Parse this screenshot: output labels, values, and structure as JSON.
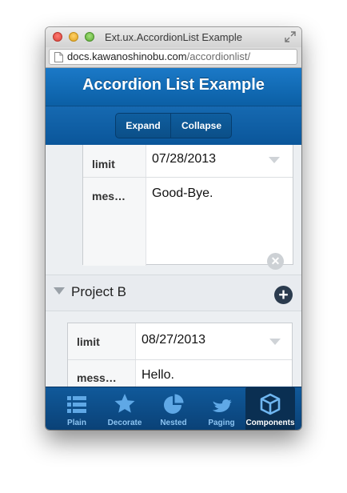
{
  "window": {
    "title": "Ext.ux.AccordionList Example"
  },
  "address_bar": {
    "domain": "docs.kawanoshinobu.com",
    "path": "/accordionlist/"
  },
  "toolbar": {
    "title": "Accordion List Example"
  },
  "segmented": {
    "expand_label": "Expand",
    "collapse_label": "Collapse"
  },
  "list": {
    "item_a": {
      "limit_label": "limit",
      "limit_value": "07/28/2013",
      "message_label": "mes…",
      "message_value": "Good-Bye."
    },
    "project_b": {
      "title": "Project B",
      "limit_label": "limit",
      "limit_value": "08/27/2013",
      "message_label": "mess…",
      "message_value": "Hello."
    }
  },
  "tabbar": {
    "tabs": [
      {
        "label": "Plain",
        "icon": "list-icon"
      },
      {
        "label": "Decorate",
        "icon": "star-icon"
      },
      {
        "label": "Nested",
        "icon": "pie-chart-icon"
      },
      {
        "label": "Paging",
        "icon": "bird-icon"
      },
      {
        "label": "Components",
        "icon": "cube-icon"
      }
    ],
    "active": "Components"
  },
  "colors": {
    "toolbar_blue": "#1b79c7",
    "tabbar_blue": "#0a4176",
    "tab_label": "#8cc4f2"
  }
}
